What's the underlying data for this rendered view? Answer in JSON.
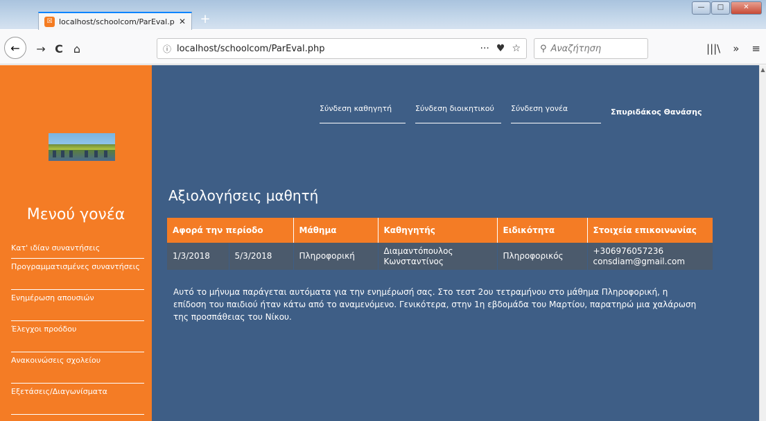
{
  "browser": {
    "tab_title": "localhost/schoolcom/ParEval.p",
    "tab_close": "✕",
    "new_tab": "+",
    "url": "localhost/schoolcom/ParEval.php",
    "url_info": "ⓘ",
    "url_more": "···",
    "url_pocket": "♥",
    "url_star": "☆",
    "search_placeholder": "Αναζήτηση",
    "search_icon": "🔍",
    "back": "←",
    "forward": "→",
    "reload": "C",
    "home": "⌂",
    "library": "|||\\",
    "overflow": "»",
    "menu": "≡",
    "win_minimize": "—",
    "win_maximize": "□",
    "win_close": "✕"
  },
  "sidebar": {
    "title": "Μενού γονέα",
    "items": [
      {
        "label": "Κατ' ιδίαν συναντήσεις"
      },
      {
        "label": "Προγραμματισμένες συναντήσεις"
      },
      {
        "label": "Ενημέρωση απουσιών"
      },
      {
        "label": "Έλεγχοι προόδου"
      },
      {
        "label": "Ανακοινώσεις σχολείου"
      },
      {
        "label": "Εξετάσεις/Διαγωνίσματα"
      }
    ]
  },
  "topnav": {
    "links": [
      {
        "label": "Σύνδεση καθηγητή"
      },
      {
        "label": "Σύνδεση διοικητικού"
      },
      {
        "label": "Σύνδεση γονέα"
      }
    ],
    "user": "Σπυριδάκος Θανάσης"
  },
  "main": {
    "title": "Αξιολογήσεις μαθητή",
    "table": {
      "headers": [
        "Αφορά την περίοδο",
        "Μάθημα",
        "Καθηγητής",
        "Ειδικότητα",
        "Στοιχεία επικοινωνίας"
      ],
      "rows": [
        {
          "from": "1/3/2018",
          "to": "5/3/2018",
          "subject": "Πληροφορική",
          "teacher": "Διαμαντόπουλος Κωνσταντίνος",
          "specialty": "Πληροφορικός",
          "phone": "+306976057236",
          "email": "consdiam@gmail.com"
        }
      ]
    },
    "message": "Αυτό το μήνυμα παράγεται αυτόματα για την ενημέρωσή σας. Στο τεστ 2ου τετραμήνου στο μάθημα Πληροφορική, η επίδοση του παιδιού ήταν κάτω από το αναμενόμενο. Γενικότερα, στην 1η εβδομάδα του Μαρτίου, παρατηρώ μια χαλάρωση της προσπάθειας του Νίκου."
  },
  "colors": {
    "sidebar": "#f47c25",
    "page_bg": "#3e5e86",
    "table_row": "#4b5a6c"
  }
}
